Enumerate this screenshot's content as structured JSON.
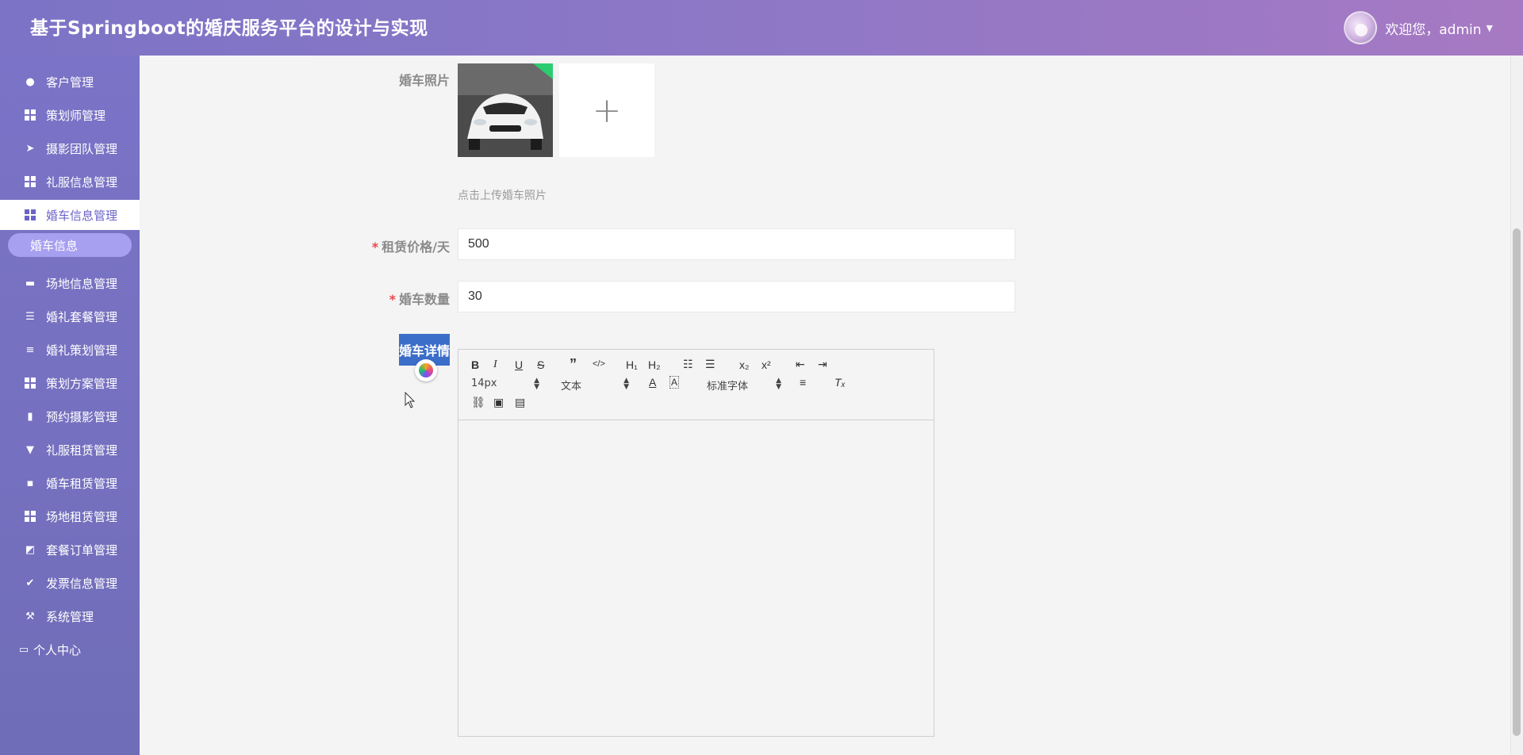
{
  "header": {
    "title": "基于Springboot的婚庆服务平台的设计与实现",
    "welcome": "欢迎您，admin"
  },
  "sidebar": {
    "items": [
      {
        "label": "客户管理",
        "icon": "bulb-icon"
      },
      {
        "label": "策划师管理",
        "icon": "grid-icon"
      },
      {
        "label": "摄影团队管理",
        "icon": "send-icon"
      },
      {
        "label": "礼服信息管理",
        "icon": "grid-icon"
      },
      {
        "label": "婚车信息管理",
        "icon": "grid-icon"
      },
      {
        "label": "场地信息管理",
        "icon": "ticket-icon"
      },
      {
        "label": "婚礼套餐管理",
        "icon": "sliders-icon"
      },
      {
        "label": "婚礼策划管理",
        "icon": "list-icon"
      },
      {
        "label": "策划方案管理",
        "icon": "grid-icon"
      },
      {
        "label": "预约摄影管理",
        "icon": "book-icon"
      },
      {
        "label": "礼服租赁管理",
        "icon": "brush-icon"
      },
      {
        "label": "婚车租赁管理",
        "icon": "chat-icon"
      },
      {
        "label": "场地租赁管理",
        "icon": "grid-icon"
      },
      {
        "label": "套餐订单管理",
        "icon": "chart-icon"
      },
      {
        "label": "发票信息管理",
        "icon": "clipboard-icon"
      },
      {
        "label": "系统管理",
        "icon": "tools-icon"
      }
    ],
    "sub_item": "婚车信息",
    "personal": "个人中心"
  },
  "form": {
    "photo_label": "婚车照片",
    "upload_hint": "点击上传婚车照片",
    "price_label": "租赁价格/天",
    "price_value": "500",
    "qty_label": "婚车数量",
    "qty_value": "30",
    "detail_label": "婚车详情"
  },
  "editor": {
    "font_size": "14px",
    "header_select": "文本",
    "font_family": "标准字体"
  },
  "colors": {
    "header_start": "#7c73c6",
    "header_end": "#a779c3",
    "sidebar": "#7570bf",
    "active_item": "#6c63c9",
    "sub_item_bg": "#a79ff0",
    "required": "#e5484d"
  }
}
